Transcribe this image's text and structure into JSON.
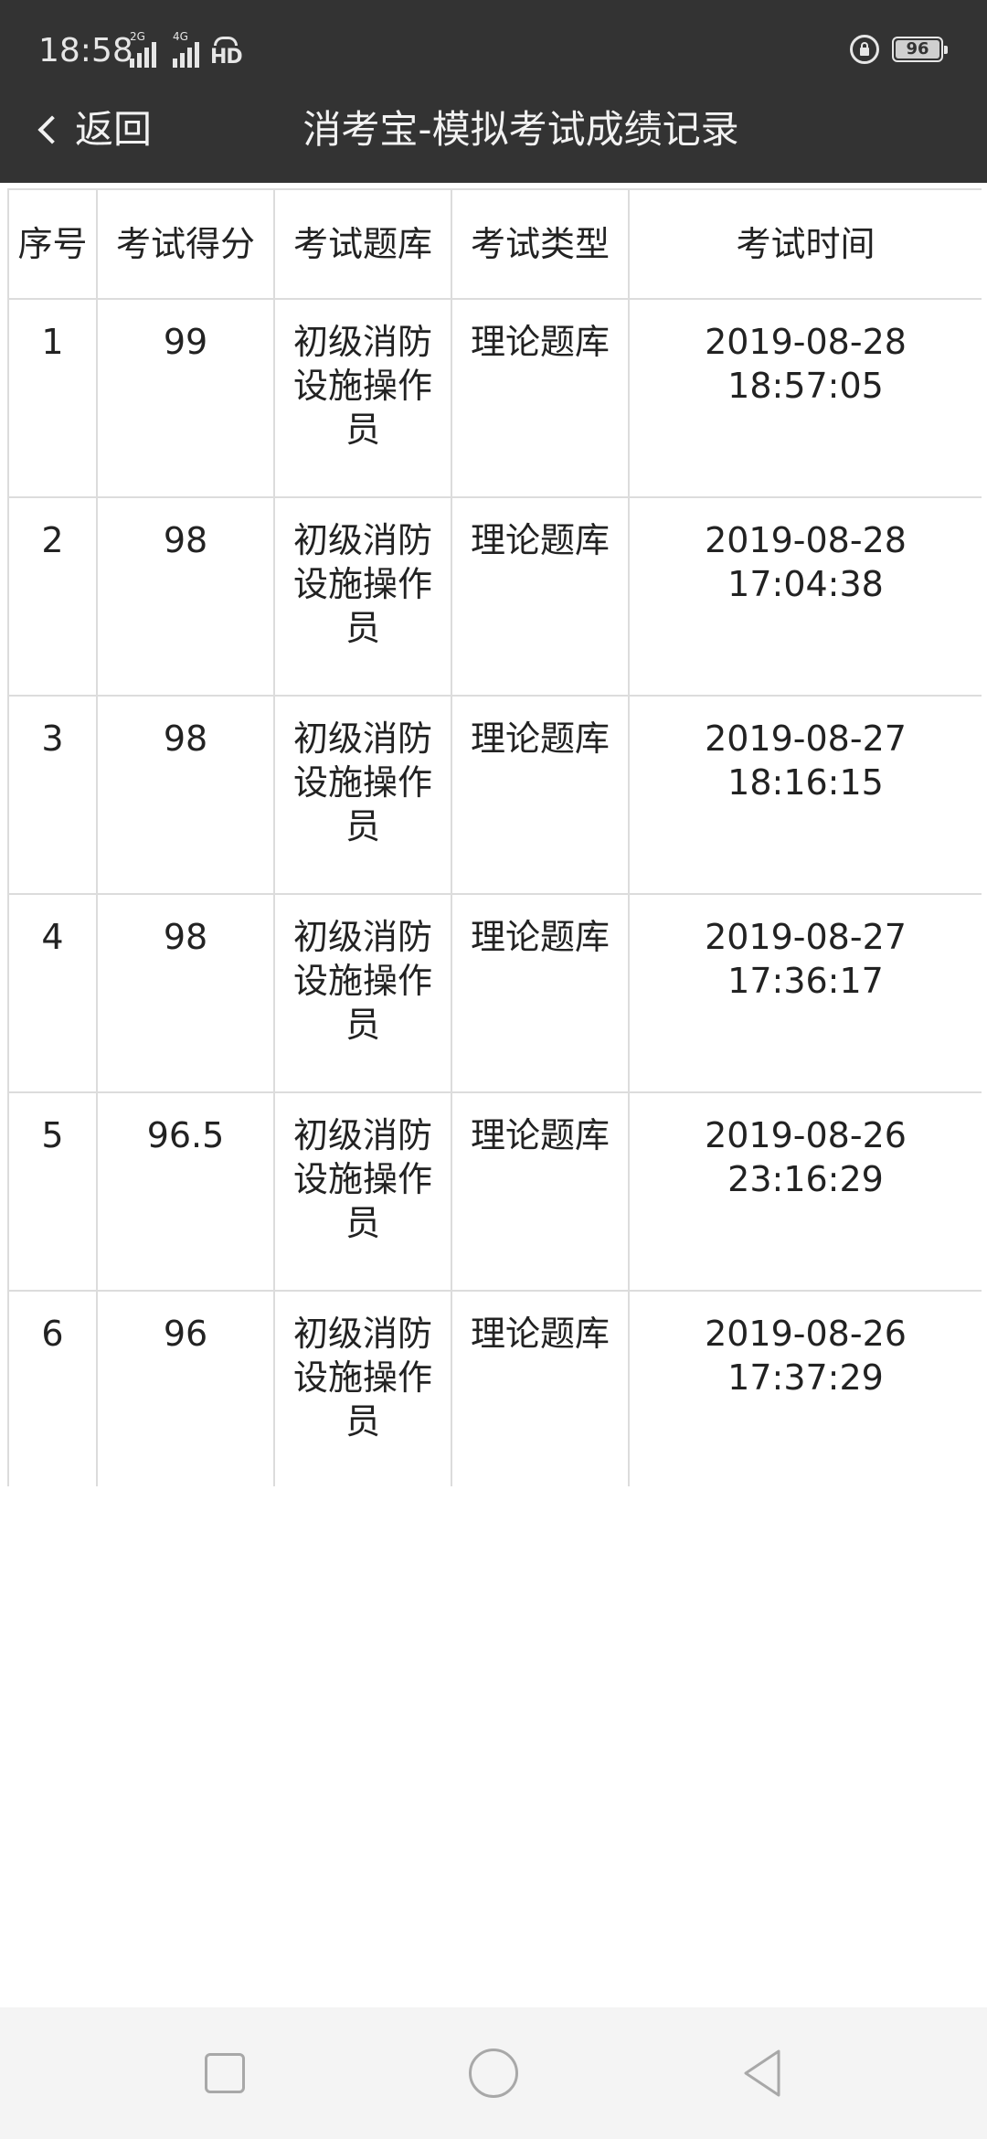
{
  "status_bar": {
    "time": "18:58",
    "signal_1_tag": "2G",
    "signal_2_tag": "4G",
    "hd_label": "HD",
    "battery": "96"
  },
  "header": {
    "back_label": "返回",
    "title": "消考宝-模拟考试成绩记录"
  },
  "table": {
    "columns": [
      "序号",
      "考试得分",
      "考试题库",
      "考试类型",
      "考试时间"
    ],
    "rows": [
      {
        "index": "1",
        "score": "99",
        "bank": "初级消防设施操作员",
        "type": "理论题库",
        "date": "2019-08-28",
        "time": "18:57:05"
      },
      {
        "index": "2",
        "score": "98",
        "bank": "初级消防设施操作员",
        "type": "理论题库",
        "date": "2019-08-28",
        "time": "17:04:38"
      },
      {
        "index": "3",
        "score": "98",
        "bank": "初级消防设施操作员",
        "type": "理论题库",
        "date": "2019-08-27",
        "time": "18:16:15"
      },
      {
        "index": "4",
        "score": "98",
        "bank": "初级消防设施操作员",
        "type": "理论题库",
        "date": "2019-08-27",
        "time": "17:36:17"
      },
      {
        "index": "5",
        "score": "96.5",
        "bank": "初级消防设施操作员",
        "type": "理论题库",
        "date": "2019-08-26",
        "time": "23:16:29"
      },
      {
        "index": "6",
        "score": "96",
        "bank": "初级消防设施操作员",
        "type": "理论题库",
        "date": "2019-08-26",
        "time": "17:37:29"
      }
    ]
  },
  "nav": {
    "icons": [
      "square-recent-apps-icon",
      "circle-home-icon",
      "triangle-back-icon"
    ]
  },
  "colors": {
    "header_bg": "#333333",
    "border": "#dcdcdc",
    "nav_bg": "#f4f4f4"
  }
}
